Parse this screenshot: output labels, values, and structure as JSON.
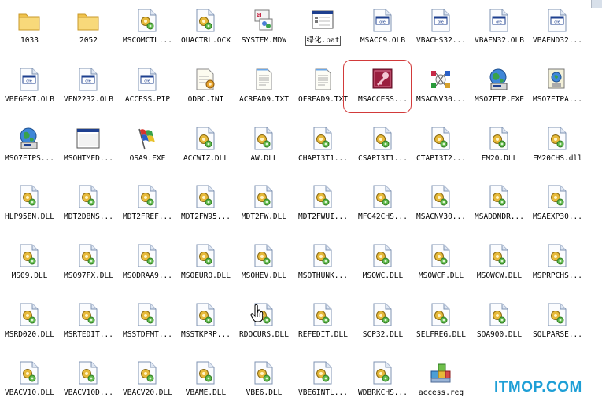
{
  "files": [
    {
      "name": "1033",
      "icon": "folder-icon"
    },
    {
      "name": "2052",
      "icon": "folder-icon"
    },
    {
      "name": "MSCOMCTL...",
      "icon": "dll-icon"
    },
    {
      "name": "OUACTRL.OCX",
      "icon": "dll-icon"
    },
    {
      "name": "SYSTEM.MDW",
      "icon": "mdw-icon"
    },
    {
      "name": "绿化.bat",
      "icon": "bat-icon"
    },
    {
      "name": "MSACC9.OLB",
      "icon": "olb-icon"
    },
    {
      "name": "VBACHS32...",
      "icon": "olb-icon"
    },
    {
      "name": "VBAEN32.OLB",
      "icon": "olb-icon"
    },
    {
      "name": "VBAEND32...",
      "icon": "olb-icon"
    },
    {
      "name": "VBE6EXT.OLB",
      "icon": "olb-icon"
    },
    {
      "name": "VEN2232.OLB",
      "icon": "olb-icon"
    },
    {
      "name": "ACCESS.PIP",
      "icon": "olb-icon"
    },
    {
      "name": "ODBC.INI",
      "icon": "ini-icon"
    },
    {
      "name": "ACREAD9.TXT",
      "icon": "txt-icon"
    },
    {
      "name": "OFREAD9.TXT",
      "icon": "txt-icon"
    },
    {
      "name": "MSACCESS...",
      "icon": "access-icon"
    },
    {
      "name": "MSACNV30...",
      "icon": "msacnv-icon"
    },
    {
      "name": "MSO7FTP.EXE",
      "icon": "globe-icon"
    },
    {
      "name": "MSO7FTPA...",
      "icon": "globe-small-icon"
    },
    {
      "name": "MSO7FTPS...",
      "icon": "globe-icon"
    },
    {
      "name": "MSOHTMED...",
      "icon": "window-icon"
    },
    {
      "name": "OSA9.EXE",
      "icon": "flag-icon"
    },
    {
      "name": "ACCWIZ.DLL",
      "icon": "dll-icon"
    },
    {
      "name": "AW.DLL",
      "icon": "dll-icon"
    },
    {
      "name": "CHAPI3T1...",
      "icon": "dll-icon"
    },
    {
      "name": "CSAPI3T1...",
      "icon": "dll-icon"
    },
    {
      "name": "CTAPI3T2...",
      "icon": "dll-icon"
    },
    {
      "name": "FM20.DLL",
      "icon": "dll-icon"
    },
    {
      "name": "FM20CHS.dll",
      "icon": "dll-icon"
    },
    {
      "name": "HLP95EN.DLL",
      "icon": "dll-icon"
    },
    {
      "name": "MDT2DBNS...",
      "icon": "dll-icon"
    },
    {
      "name": "MDT2FREF...",
      "icon": "dll-icon"
    },
    {
      "name": "MDT2FW95...",
      "icon": "dll-icon"
    },
    {
      "name": "MDT2FW.DLL",
      "icon": "dll-icon"
    },
    {
      "name": "MDT2FWUI...",
      "icon": "dll-icon"
    },
    {
      "name": "MFC42CHS...",
      "icon": "dll-icon"
    },
    {
      "name": "MSACNV30...",
      "icon": "dll-icon"
    },
    {
      "name": "MSADDNDR...",
      "icon": "dll-icon"
    },
    {
      "name": "MSAEXP30...",
      "icon": "dll-icon"
    },
    {
      "name": "MS09.DLL",
      "icon": "dll-icon"
    },
    {
      "name": "MSO97FX.DLL",
      "icon": "dll-icon"
    },
    {
      "name": "MSODRAA9...",
      "icon": "dll-icon"
    },
    {
      "name": "MSOEURO.DLL",
      "icon": "dll-icon"
    },
    {
      "name": "MSOHEV.DLL",
      "icon": "dll-icon"
    },
    {
      "name": "MSOTHUNK...",
      "icon": "dll-icon"
    },
    {
      "name": "MSOWC.DLL",
      "icon": "dll-icon"
    },
    {
      "name": "MSOWCF.DLL",
      "icon": "dll-icon"
    },
    {
      "name": "MSOWCW.DLL",
      "icon": "dll-icon"
    },
    {
      "name": "MSPRPCHS...",
      "icon": "dll-icon"
    },
    {
      "name": "MSRD020.DLL",
      "icon": "dll-icon"
    },
    {
      "name": "MSRTEDIT...",
      "icon": "dll-icon"
    },
    {
      "name": "MSSTDFMT...",
      "icon": "dll-icon"
    },
    {
      "name": "MSSTKPRP...",
      "icon": "dll-icon"
    },
    {
      "name": "RDOCURS.DLL",
      "icon": "dll-icon"
    },
    {
      "name": "REFEDIT.DLL",
      "icon": "dll-icon"
    },
    {
      "name": "SCP32.DLL",
      "icon": "dll-icon"
    },
    {
      "name": "SELFREG.DLL",
      "icon": "dll-icon"
    },
    {
      "name": "SOA900.DLL",
      "icon": "dll-icon"
    },
    {
      "name": "SQLPARSE...",
      "icon": "dll-icon"
    },
    {
      "name": "VBACV10.DLL",
      "icon": "dll-icon"
    },
    {
      "name": "VBACV10D...",
      "icon": "dll-icon"
    },
    {
      "name": "VBACV20.DLL",
      "icon": "dll-icon"
    },
    {
      "name": "VBAME.DLL",
      "icon": "dll-icon"
    },
    {
      "name": "VBE6.DLL",
      "icon": "dll-icon"
    },
    {
      "name": "VBE6INTL...",
      "icon": "dll-icon"
    },
    {
      "name": "WDBRKCHS...",
      "icon": "dll-icon"
    },
    {
      "name": "access.reg",
      "icon": "reg-icon"
    }
  ],
  "highlighted_index": 16,
  "boxed_label_index": 5,
  "watermark": "ITMOP.COM",
  "colors": {
    "highlight_ring": "#d23a3a",
    "watermark": "#1e9fd6",
    "folder": "#f5d267",
    "access_bg": "#9a1f3f"
  }
}
